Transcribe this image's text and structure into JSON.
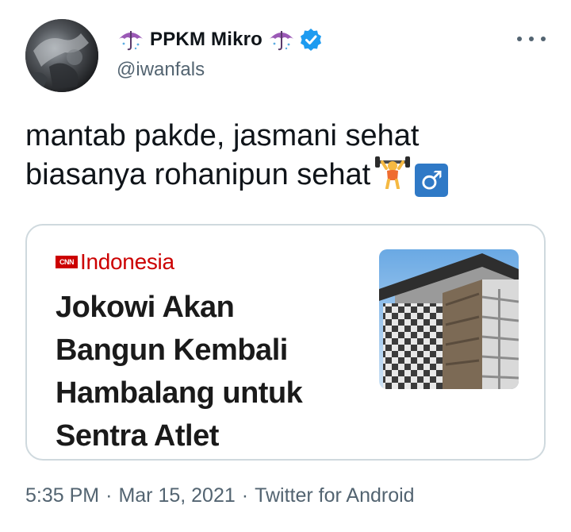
{
  "tweet": {
    "display_name": "PPKM Mikro",
    "handle": "@iwanfals",
    "text_line_1": "mantab pakde, jasmani sehat",
    "text_line_2": "biasanya rohanipun sehat",
    "male_sign": "♂",
    "icons": [
      "umbrella-icon",
      "verified-badge-icon",
      "weightlifter-emoji",
      "more-options-icon"
    ]
  },
  "card": {
    "brand_badge": "CNN",
    "brand_name": "Indonesia",
    "headline_lines": [
      "Jokowi Akan",
      "Bangun Kembali",
      "Hambalang untuk",
      "Sentra Atlet"
    ]
  },
  "meta": {
    "time": "5:35 PM",
    "separator": "·",
    "date": "Mar 15, 2021",
    "source": "Twitter for Android"
  },
  "colors": {
    "verified": "#1d9bf0",
    "cnn_red": "#cc0000",
    "secondary_text": "#536471",
    "card_border": "#cfd9de"
  }
}
